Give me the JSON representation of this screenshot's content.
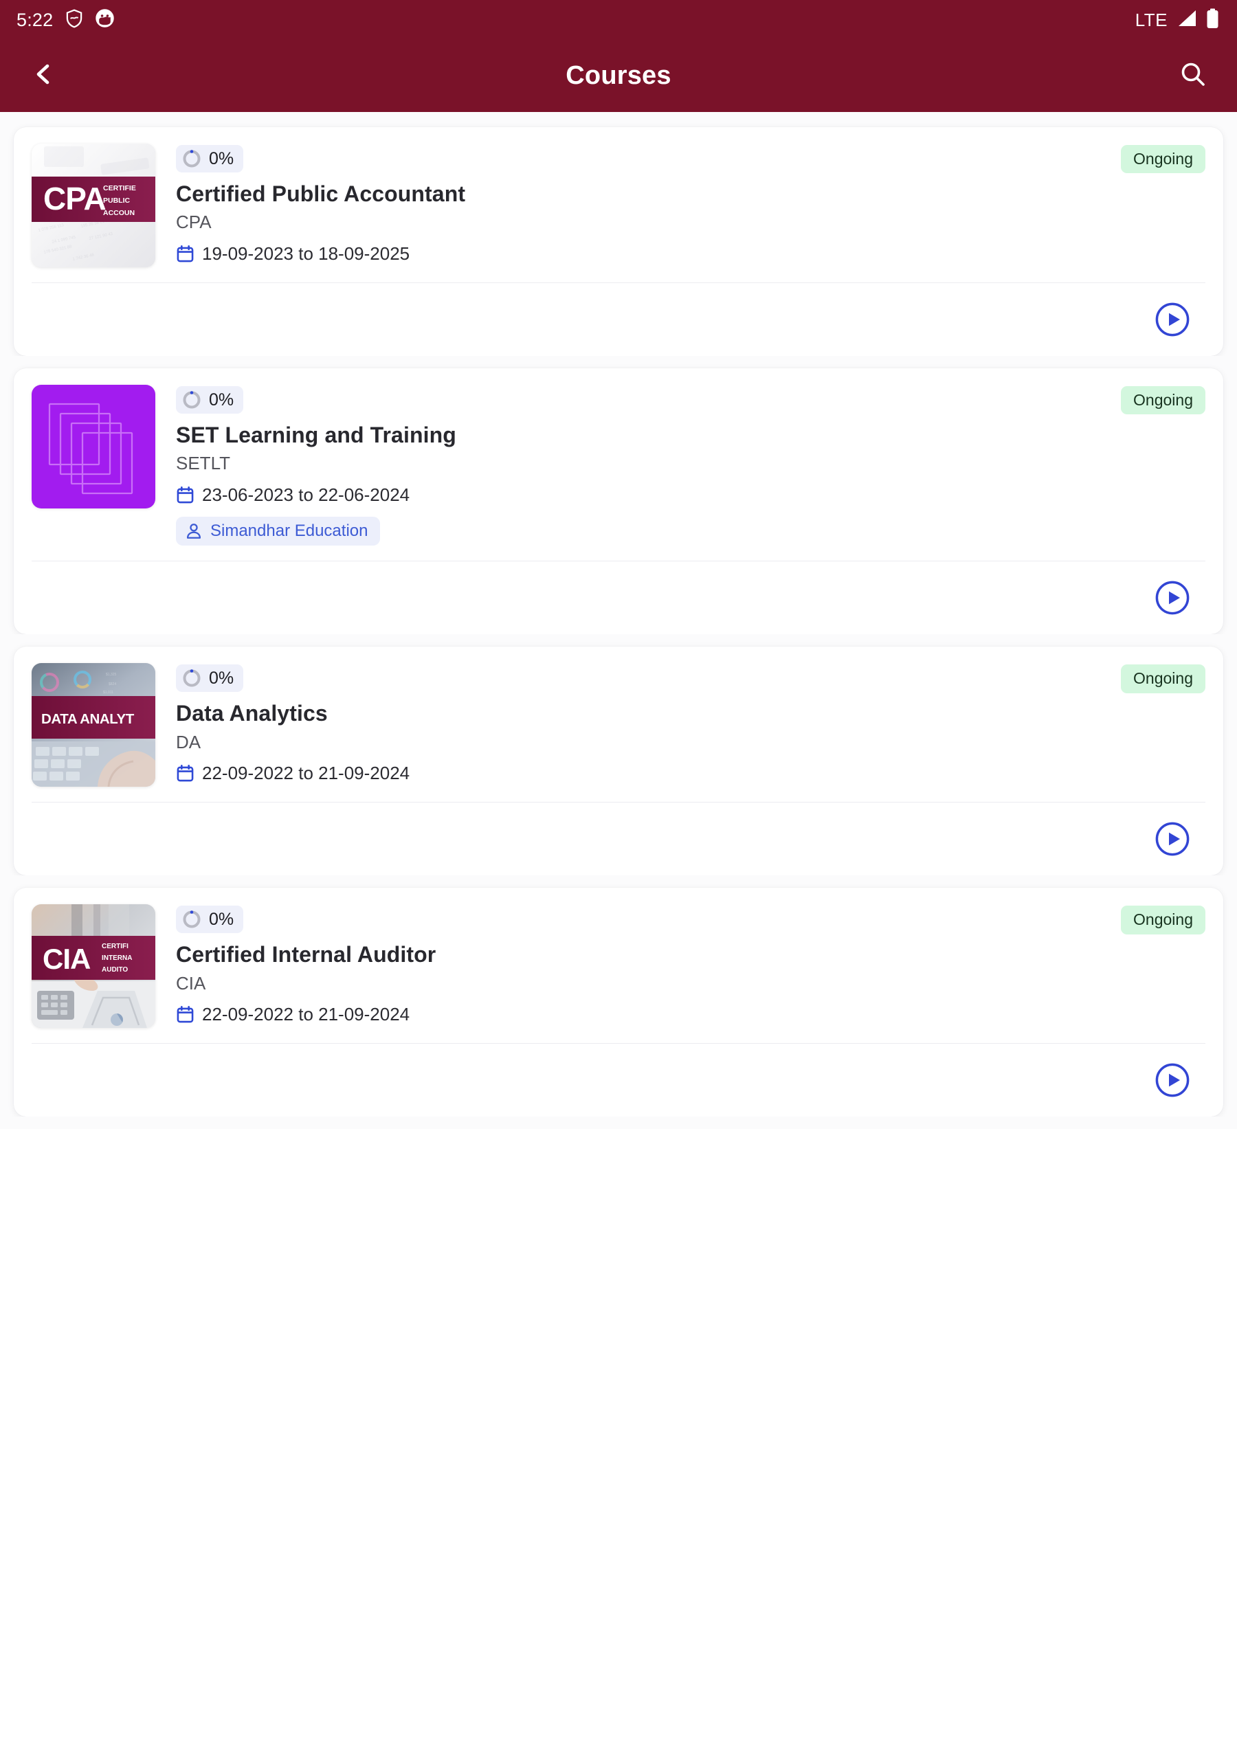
{
  "status_bar": {
    "time": "5:22",
    "icons_left": [
      "shield-icon",
      "face-circle-icon"
    ],
    "network_label": "LTE",
    "icons_right": [
      "signal-bars-icon",
      "battery-icon"
    ]
  },
  "app_bar": {
    "back_icon": "chevron-left-icon",
    "title": "Courses",
    "search_icon": "search-icon"
  },
  "colors": {
    "brand_maroon": "#7A1229",
    "accent_blue": "#3B4FD8",
    "badge_green_bg": "#D3F7DE",
    "badge_green_text": "#18331F",
    "pill_blue_bg": "#ECEFFB",
    "progress_pill_bg": "#EEF0FA",
    "progress_ring_track": "#B9BAC4",
    "page_bg": "#FBFBFC",
    "card_bg": "#FFFFFF"
  },
  "courses": [
    {
      "progress": "0%",
      "progress_value": 0,
      "title": "Certified Public Accountant",
      "code": "CPA",
      "dates": "19-09-2023 to 18-09-2025",
      "instructor": null,
      "status": "Ongoing",
      "thumbnail": {
        "kind": "photo-banner",
        "banner_text_main": "CPA",
        "banner_text_sub": "CERTIFIED PUBLIC ACCOUNTANT",
        "banner_color": "#7D1742"
      },
      "play_icon": "play-circle-icon"
    },
    {
      "progress": "0%",
      "progress_value": 0,
      "title": "SET Learning and Training",
      "code": "SETLT",
      "dates": "23-06-2023 to 22-06-2024",
      "instructor": "Simandhar Education",
      "status": "Ongoing",
      "thumbnail": {
        "kind": "purple-squares",
        "banner_text_main": "",
        "banner_text_sub": "",
        "banner_color": "#A21CEF"
      },
      "play_icon": "play-circle-icon"
    },
    {
      "progress": "0%",
      "progress_value": 0,
      "title": "Data Analytics",
      "code": "DA",
      "dates": "22-09-2022 to 21-09-2024",
      "instructor": null,
      "status": "Ongoing",
      "thumbnail": {
        "kind": "photo-banner",
        "banner_text_main": "DATA ANALYTICS",
        "banner_text_sub": "",
        "banner_color": "#7D1742"
      },
      "play_icon": "play-circle-icon"
    },
    {
      "progress": "0%",
      "progress_value": 0,
      "title": "Certified Internal Auditor",
      "code": "CIA",
      "dates": "22-09-2022 to 21-09-2024",
      "instructor": null,
      "status": "Ongoing",
      "thumbnail": {
        "kind": "photo-banner",
        "banner_text_main": "CIA",
        "banner_text_sub": "CERTIFIED INTERNAL AUDITOR",
        "banner_color": "#7D1742"
      },
      "play_icon": "play-circle-icon"
    }
  ]
}
